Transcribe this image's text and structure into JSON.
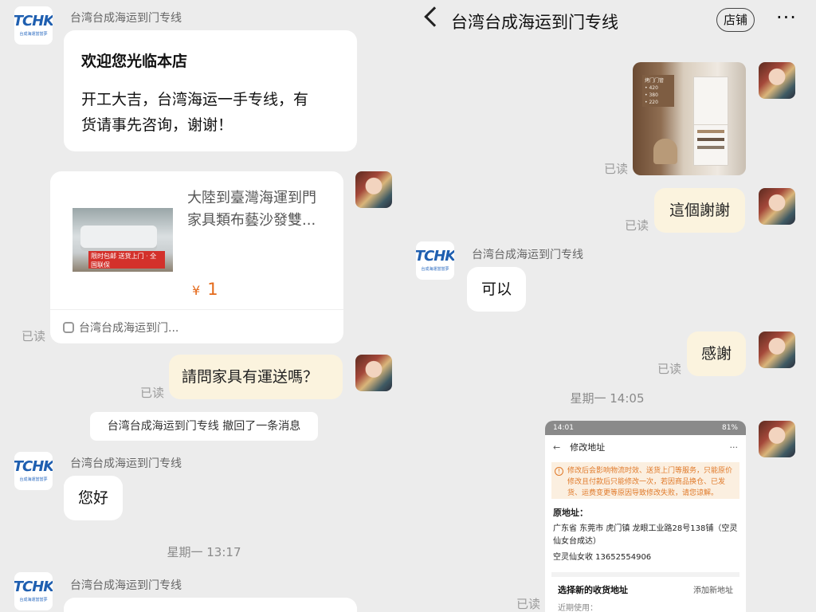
{
  "shop": {
    "name": "台湾台成海运到门专线",
    "logo_text": "TCHK",
    "logo_sub": "台成海運當當夢"
  },
  "left": {
    "welcome": {
      "title": "欢迎您光临本店",
      "body_line1": "开工大吉，台湾海运一手专线，有",
      "body_line2": "货请事先咨询，谢谢！"
    },
    "product_card": {
      "title_line1": "大陸到臺灣海運到門",
      "title_line2": "家具類布藝沙發雙...",
      "image_banner": "限时包邮 送货上门 · 全国联保",
      "price_symbol": "¥",
      "price": "1",
      "shop_label": "台湾台成海运到门..."
    },
    "read_label_1": "已读",
    "question": "請問家具有運送嗎？",
    "read_label_2": "已读",
    "system_notice": "台湾台成海运到门专线 撤回了一条消息",
    "greeting": "您好",
    "time_1": "星期一 13:17"
  },
  "right": {
    "header": {
      "back_icon": "chevron-left-icon",
      "title": "台湾台成海运到门专线",
      "store_button": "店铺",
      "more_icon": "more-icon"
    },
    "cabinet_labels": [
      "烤门门管",
      "• 420",
      "• 380",
      "• 220"
    ],
    "read_label_1": "已读",
    "thanks_msg": "這個謝謝",
    "read_label_2": "已读",
    "reply_ok": "可以",
    "thanks_msg_2": "感謝",
    "read_label_3": "已读",
    "time_2": "星期一 14:05",
    "read_label_4": "已读",
    "screenshot": {
      "status_time": "14:01",
      "status_right": "81%",
      "title": "修改地址",
      "warning": "修改后会影响物流时效、送货上门等服务，只能原价修改且付款后只能修改一次，若因商品换仓、已发货、运费变更等原因导致修改失败，请您谅解。",
      "orig_label": "原地址：",
      "addr_line1": "广东省 东莞市 虎门镇 龙眼工业路28号138铺（空灵",
      "addr_line2": "仙女台成达）",
      "recipient": "空灵仙女收 13652554906",
      "select_label": "选择新的收货地址",
      "add_label": "添加新地址",
      "recent_label": "近期使用："
    }
  },
  "colors": {
    "background": "#ececec",
    "outgoing_bubble": "#fbf3de",
    "incoming_bubble": "#ffffff",
    "price": "#e46a1b",
    "logo_blue": "#1f5fb0"
  }
}
